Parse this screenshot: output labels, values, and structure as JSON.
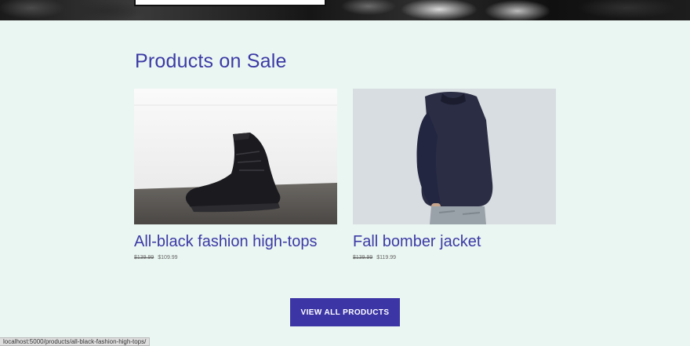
{
  "section": {
    "title": "Products on Sale"
  },
  "products": [
    {
      "name": "All-black fashion high-tops",
      "old_price": "$139.99",
      "price": "$109.99",
      "image": "black high-top sneaker on table"
    },
    {
      "name": "Fall bomber jacket",
      "old_price": "$139.99",
      "price": "$119.99",
      "image": "man wearing navy bomber jacket"
    }
  ],
  "cta": {
    "label": "VIEW ALL PRODUCTS"
  },
  "status_bar": {
    "url": "localhost:5000/products/all-black-fashion-high-tops/"
  },
  "colors": {
    "background": "#eaf6f1",
    "accent": "#3c3aa6",
    "button": "#3c35a6"
  }
}
